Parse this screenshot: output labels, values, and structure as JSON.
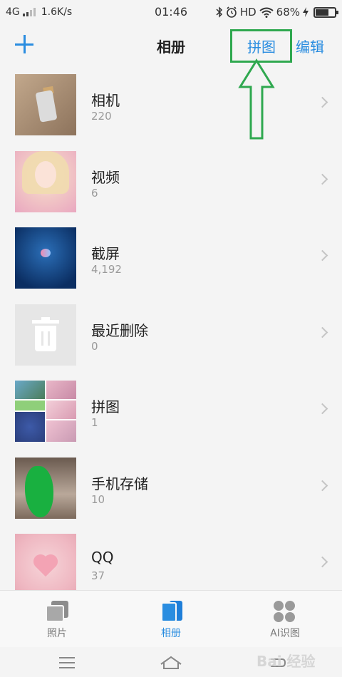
{
  "status_bar": {
    "network": "4G",
    "speed": "1.6K/s",
    "time": "01:46",
    "hd": "HD",
    "battery": "68%",
    "battery_level": 0.68,
    "icons": [
      "signal-icon",
      "bluetooth-icon",
      "alarm-icon",
      "wifi-icon",
      "charging-icon",
      "battery-icon"
    ]
  },
  "header": {
    "title": "相册",
    "add_icon": "plus-icon",
    "collage_label": "拼图",
    "edit_label": "编辑"
  },
  "annotation": {
    "highlight_color": "#2fa84f",
    "arrow_direction": "up"
  },
  "albums": [
    {
      "name": "相机",
      "count": "220"
    },
    {
      "name": "视频",
      "count": "6"
    },
    {
      "name": "截屏",
      "count": "4,192"
    },
    {
      "name": "最近删除",
      "count": "0"
    },
    {
      "name": "拼图",
      "count": "1"
    },
    {
      "name": "手机存储",
      "count": "10"
    },
    {
      "name": "QQ",
      "count": "37"
    }
  ],
  "tabs": [
    {
      "label": "照片",
      "icon": "photos-icon",
      "active": false
    },
    {
      "label": "相册",
      "icon": "albums-icon",
      "active": true
    },
    {
      "label": "AI识图",
      "icon": "ai-recognition-icon",
      "active": false
    }
  ],
  "system_nav": {
    "buttons": [
      "menu-icon",
      "home-icon",
      "back-icon"
    ]
  },
  "watermark": "Bai 经验",
  "colors": {
    "accent": "#2a8de0",
    "annotation_green": "#2fa84f",
    "background": "#f4f4f4",
    "secondary_text": "#999999"
  }
}
